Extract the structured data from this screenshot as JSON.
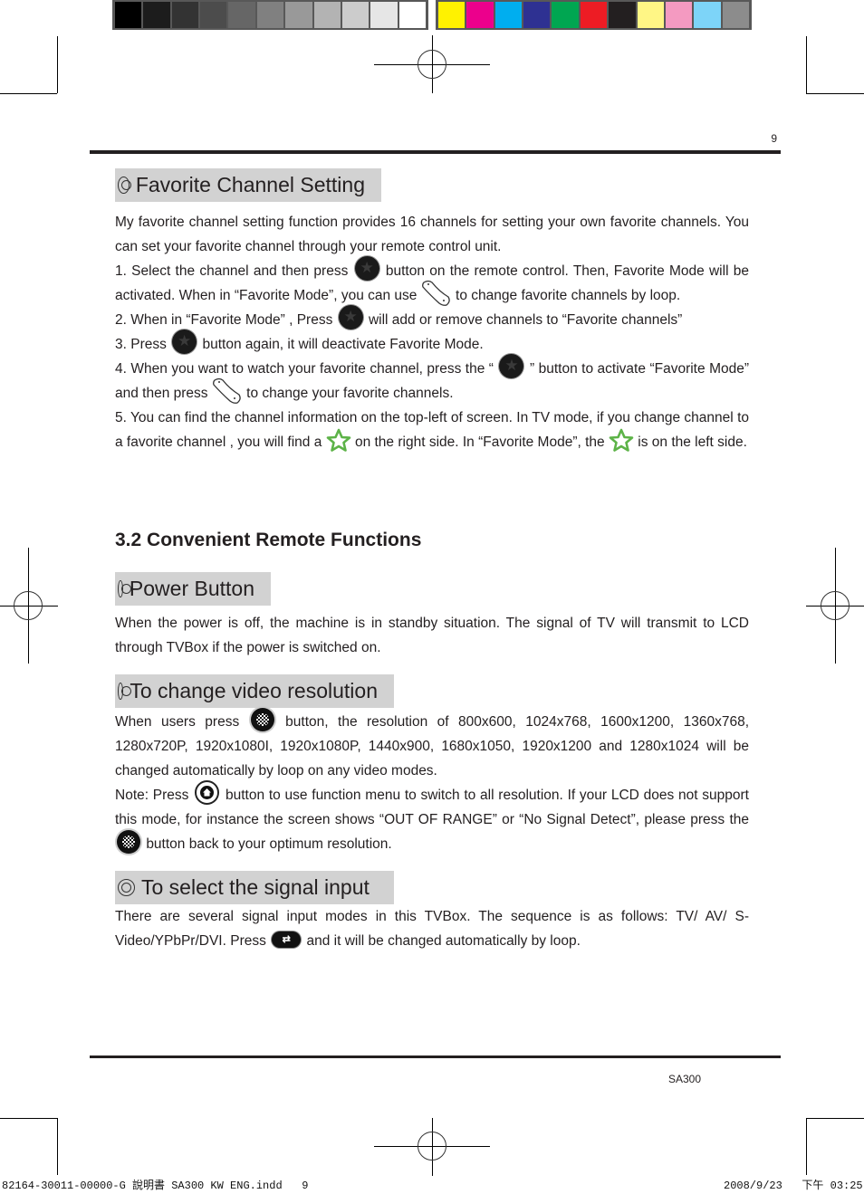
{
  "color_bars": {
    "gray_swatches": [
      "#000000",
      "#1c1c1c",
      "#333333",
      "#4c4c4c",
      "#666666",
      "#808080",
      "#999999",
      "#b3b3b3",
      "#cccccc",
      "#e6e6e6",
      "#ffffff"
    ],
    "color_swatches": [
      "#fff200",
      "#ec008c",
      "#00aeef",
      "#2e3192",
      "#00a651",
      "#ed1c24",
      "#231f20",
      "#fff685",
      "#f49ac1",
      "#7dd4f8",
      "#8c8c8c"
    ]
  },
  "page_number": "9",
  "sections": {
    "favorite": {
      "heading": "Favorite Channel Setting",
      "intro": "My favorite channel setting function provides 16 channels for setting your own favorite channels. You can set your favorite channel through your remote control unit.",
      "step1_a": "1. Select the channel and then press",
      "step1_b": "button on the remote control. Then, Favorite Mode will be activated. When in “Favorite Mode”, you can use",
      "step1_c": "to change favorite channels by loop.",
      "step2_a": "2. When in “Favorite Mode” , Press",
      "step2_b": "will add or remove channels to “Favorite channels”",
      "step3_a": "3. Press",
      "step3_b": "button again, it will deactivate Favorite Mode.",
      "step4_a": "4. When you want to watch your favorite channel, press the “",
      "step4_b": "” button to activate “Favorite Mode” and then press",
      "step4_c": "to change your favorite channels.",
      "step5_a": "5. You can find the channel information on the top-left of screen. In TV mode, if you change channel to a favorite channel , you will find a",
      "step5_b": "on the right side. In “Favorite Mode”, the",
      "step5_c": "is on the left side."
    },
    "chapter_title": "3.2 Convenient Remote Functions",
    "power": {
      "heading": "Power Button",
      "body": "When the power is off, the machine is in standby situation. The signal of TV will transmit to LCD through TVBox if the power is switched on."
    },
    "resolution": {
      "heading": "To change video resolution",
      "body_a": "When users press",
      "body_b": "button, the resolution of 800x600, 1024x768, 1600x1200, 1360x768, 1280x720P, 1920x1080I, 1920x1080P, 1440x900, 1680x1050, 1920x1200 and 1280x1024 will be changed automatically by loop on any video modes.",
      "note_a": "Note: Press",
      "note_b": "button to use function menu to switch to all resolution. If your LCD does not support this mode, for instance the screen shows “OUT OF RANGE” or “No Signal Detect”, please press the",
      "note_c": "button back to your optimum resolution."
    },
    "signal": {
      "heading": "To select the signal input",
      "body_a": "There are several signal input modes in this TVBox. The sequence is as follows: TV/ AV/ S-Video/YPbPr/DVI. Press",
      "body_b": "and it will be changed automatically by loop."
    }
  },
  "icons": {
    "favorite_button_glyph": "★",
    "source_button_glyph": "⇄",
    "green_star_color": "#5db348"
  },
  "footer": {
    "model": "SA300",
    "slug_left": "82164-30011-00000-G 說明書 SA300 KW ENG.indd   9",
    "slug_right": "2008/9/23   下午 03:25:"
  }
}
